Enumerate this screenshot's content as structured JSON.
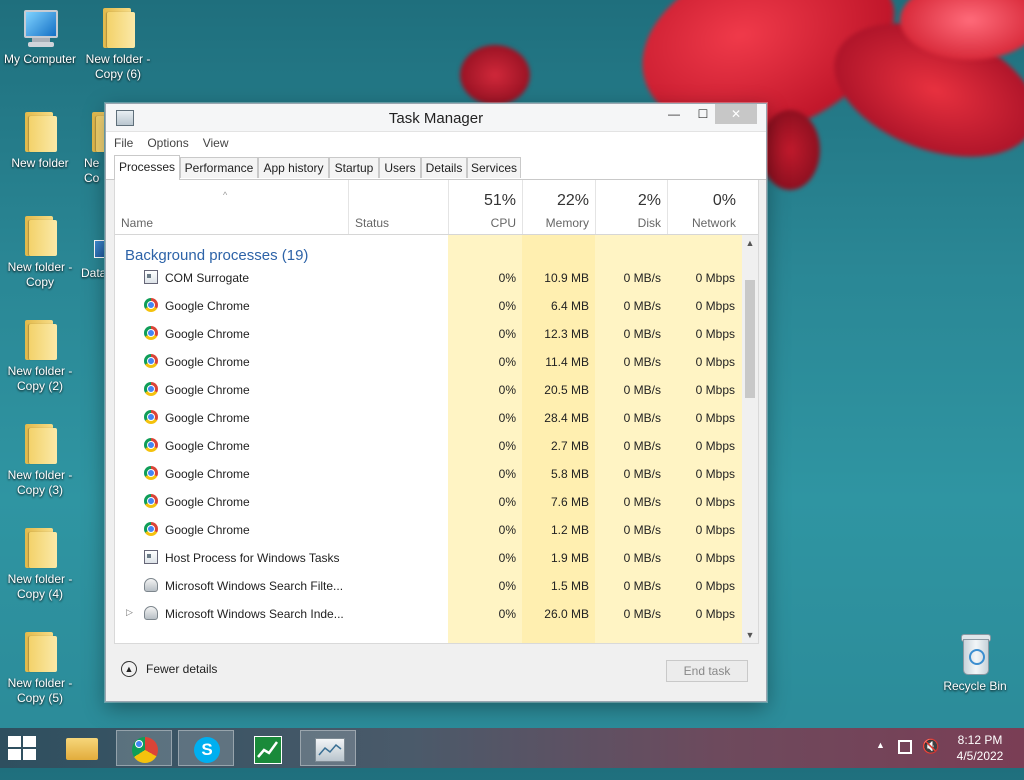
{
  "desktop": {
    "icons": [
      {
        "label": "My Computer"
      },
      {
        "label": "New folder - Copy (6)"
      },
      {
        "label": "New folder"
      },
      {
        "label": "New folder - Copy"
      },
      {
        "label": "New folder - Copy (2)"
      },
      {
        "label": "New folder - Copy (3)"
      },
      {
        "label": "New folder - Copy (4)"
      },
      {
        "label": "New folder - Copy (5)"
      },
      {
        "label": "Recycle Bin"
      }
    ],
    "partial_icons": [
      "Ne",
      "Co",
      "Data"
    ]
  },
  "window": {
    "title": "Task Manager",
    "minimize": "—",
    "maximize": "☐",
    "close": "✕"
  },
  "menu": [
    "File",
    "Options",
    "View"
  ],
  "tabs": [
    "Processes",
    "Performance",
    "App history",
    "Startup",
    "Users",
    "Details",
    "Services"
  ],
  "columns": {
    "name": "Name",
    "status": "Status",
    "cpu": {
      "pct": "51%",
      "label": "CPU"
    },
    "memory": {
      "pct": "22%",
      "label": "Memory"
    },
    "disk": {
      "pct": "2%",
      "label": "Disk"
    },
    "network": {
      "pct": "0%",
      "label": "Network"
    }
  },
  "group_title": "Background processes (19)",
  "processes": [
    {
      "name": "COM Surrogate",
      "icon": "system-process-icon",
      "cpu": "0%",
      "memory": "10.9 MB",
      "disk": "0 MB/s",
      "network": "0 Mbps"
    },
    {
      "name": "Google Chrome",
      "icon": "chrome-icon",
      "cpu": "0%",
      "memory": "6.4 MB",
      "disk": "0 MB/s",
      "network": "0 Mbps"
    },
    {
      "name": "Google Chrome",
      "icon": "chrome-icon",
      "cpu": "0%",
      "memory": "12.3 MB",
      "disk": "0 MB/s",
      "network": "0 Mbps"
    },
    {
      "name": "Google Chrome",
      "icon": "chrome-icon",
      "cpu": "0%",
      "memory": "11.4 MB",
      "disk": "0 MB/s",
      "network": "0 Mbps"
    },
    {
      "name": "Google Chrome",
      "icon": "chrome-icon",
      "cpu": "0%",
      "memory": "20.5 MB",
      "disk": "0 MB/s",
      "network": "0 Mbps"
    },
    {
      "name": "Google Chrome",
      "icon": "chrome-icon",
      "cpu": "0%",
      "memory": "28.4 MB",
      "disk": "0 MB/s",
      "network": "0 Mbps"
    },
    {
      "name": "Google Chrome",
      "icon": "chrome-icon",
      "cpu": "0%",
      "memory": "2.7 MB",
      "disk": "0 MB/s",
      "network": "0 Mbps"
    },
    {
      "name": "Google Chrome",
      "icon": "chrome-icon",
      "cpu": "0%",
      "memory": "5.8 MB",
      "disk": "0 MB/s",
      "network": "0 Mbps"
    },
    {
      "name": "Google Chrome",
      "icon": "chrome-icon",
      "cpu": "0%",
      "memory": "7.6 MB",
      "disk": "0 MB/s",
      "network": "0 Mbps"
    },
    {
      "name": "Google Chrome",
      "icon": "chrome-icon",
      "cpu": "0%",
      "memory": "1.2 MB",
      "disk": "0 MB/s",
      "network": "0 Mbps"
    },
    {
      "name": "Host Process for Windows Tasks",
      "icon": "system-process-icon",
      "cpu": "0%",
      "memory": "1.9 MB",
      "disk": "0 MB/s",
      "network": "0 Mbps"
    },
    {
      "name": "Microsoft Windows Search Filte...",
      "icon": "user-process-icon",
      "cpu": "0%",
      "memory": "1.5 MB",
      "disk": "0 MB/s",
      "network": "0 Mbps"
    },
    {
      "name": "Microsoft Windows Search Inde...",
      "icon": "user-process-icon",
      "cpu": "0%",
      "memory": "26.0 MB",
      "disk": "0 MB/s",
      "network": "0 Mbps",
      "expandable": true
    }
  ],
  "footer": {
    "fewer_details": "Fewer details",
    "end_task": "End task"
  },
  "taskbar": {
    "apps": [
      "file-explorer-icon",
      "chrome-icon",
      "skype-icon",
      "stock-chart-icon",
      "task-manager-icon"
    ],
    "clock_time": "8:12 PM",
    "clock_date": "4/5/2022"
  },
  "colors": {
    "heat_column": "#fff4c4",
    "heat_column_strong": "#ffefb0",
    "group_title": "#2d63a8"
  }
}
